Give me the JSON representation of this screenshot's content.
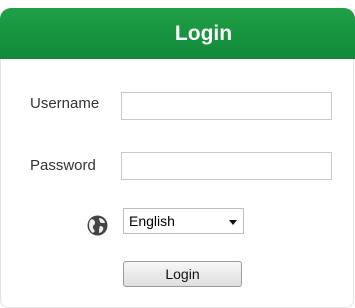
{
  "header": {
    "title": "Login"
  },
  "form": {
    "username_label": "Username",
    "username_value": "",
    "username_placeholder": "",
    "password_label": "Password",
    "password_value": "",
    "password_placeholder": ""
  },
  "language": {
    "icon": "globe-icon",
    "selected": "English"
  },
  "login_button": {
    "label": "Login"
  },
  "colors": {
    "header_green": "#18963f",
    "header_text": "#ffffff"
  }
}
